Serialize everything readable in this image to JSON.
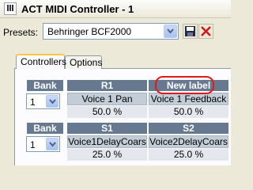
{
  "window": {
    "title": "ACT MIDI Controller  - 1"
  },
  "presets": {
    "label": "Presets:",
    "selected": "Behringer BCF2000"
  },
  "tabs": [
    {
      "label": "Controllers",
      "active": true
    },
    {
      "label": "Options",
      "active": false
    }
  ],
  "banks": [
    {
      "label": "Bank",
      "value": "1",
      "controls": [
        {
          "title": "R1",
          "name": "Voice 1 Pan",
          "value": "50.0 %"
        },
        {
          "title": "New label",
          "name": "Voice 1 Feedback",
          "value": "50.0 %"
        }
      ]
    },
    {
      "label": "Bank",
      "value": "1",
      "controls": [
        {
          "title": "S1",
          "name": "Voice1DelayCoars",
          "value": "25.0 %"
        },
        {
          "title": "S2",
          "name": "Voice2DelayCoars",
          "value": "25.0 %"
        }
      ]
    }
  ],
  "icons": {
    "app": "midi-keyboard-icon",
    "save": "floppy-disk-icon",
    "delete": "red-x-icon",
    "dropdown": "chevron-down-icon"
  },
  "colors": {
    "header_bg": "#677891",
    "name_bg": "#C3CDD8",
    "value_bg": "#E4E8EE",
    "highlight": "#E21A1A"
  }
}
